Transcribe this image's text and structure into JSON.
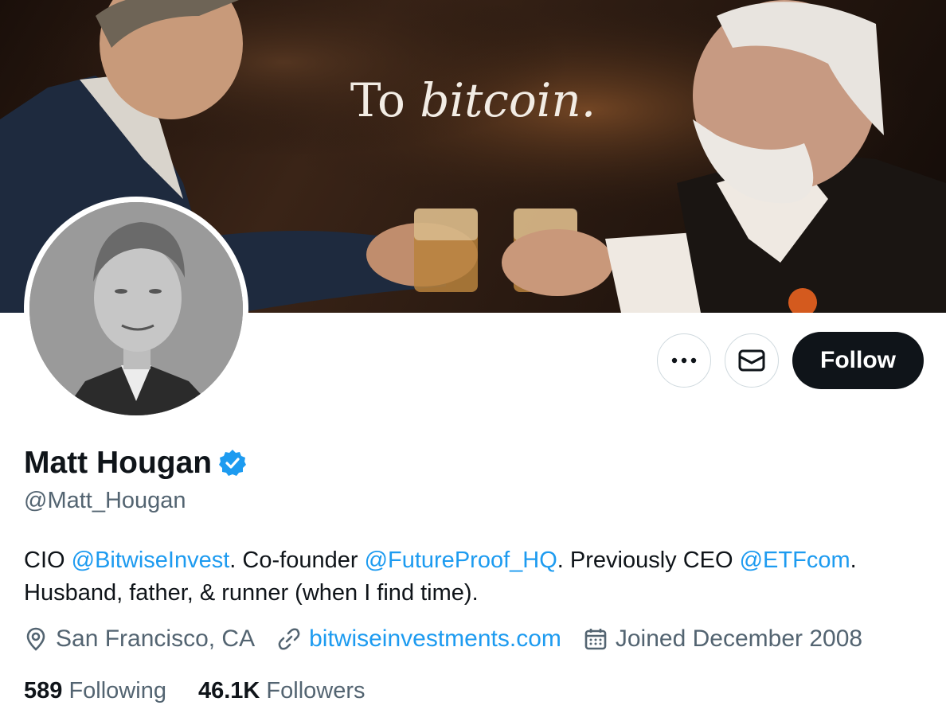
{
  "banner": {
    "caption_plain": "To ",
    "caption_italic": "bitcoin."
  },
  "actions": {
    "more_label": "More",
    "message_label": "Message",
    "follow_label": "Follow"
  },
  "profile": {
    "name": "Matt Hougan",
    "handle": "@Matt_Hougan",
    "verified": true,
    "bio": {
      "p1": "CIO ",
      "m1": "@BitwiseInvest",
      "p2": ". Co-founder ",
      "m2": "@FutureProof_HQ",
      "p3": ". Previously CEO ",
      "m3": "@ETFcom",
      "p4": ".",
      "line2": "Husband, father, & runner (when I find time)."
    },
    "location": "San Francisco, CA",
    "website": "bitwiseinvestments.com",
    "joined": "Joined December 2008"
  },
  "stats": {
    "following_count": "589",
    "following_label": "Following",
    "followers_count": "46.1K",
    "followers_label": "Followers"
  },
  "colors": {
    "accent": "#1d9bf0",
    "text": "#0f1419",
    "muted": "#536471",
    "border": "#cfd9de"
  },
  "icons": [
    "more-icon",
    "mail-icon",
    "verified-badge-icon",
    "location-pin-icon",
    "link-icon",
    "calendar-icon"
  ]
}
